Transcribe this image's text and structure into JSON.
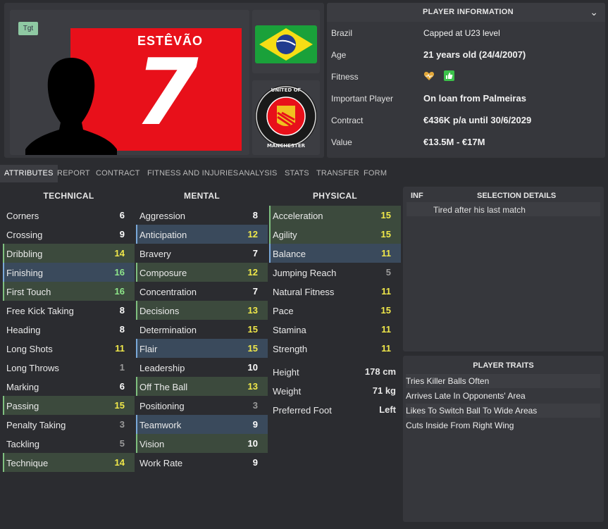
{
  "profile": {
    "badge": "Tgt",
    "shirt_name": "ESTÊVÃO",
    "shirt_number": "7",
    "flag": "Brazil flag",
    "club_crest_text": "FOOTBALL CLUB UNITED OF MANCHESTER"
  },
  "player_info": {
    "title": "PLAYER INFORMATION",
    "rows": [
      {
        "label": "Brazil",
        "value": "Capped at U23 level"
      },
      {
        "label": "Age",
        "value": "21 years old (24/4/2007)"
      },
      {
        "label": "Fitness",
        "value": ""
      },
      {
        "label": "Important Player",
        "value": "On loan from Palmeiras"
      },
      {
        "label": "Contract",
        "value": "€436K p/a until 30/6/2029"
      },
      {
        "label": "Value",
        "value": "€13.5M - €17M"
      }
    ]
  },
  "tabs": [
    "ATTRIBUTES",
    "REPORT",
    "CONTRACT",
    "FITNESS AND INJURIES",
    "ANALYSIS",
    "STATS",
    "TRANSFER",
    "FORM"
  ],
  "columns": {
    "technical": "TECHNICAL",
    "mental": "MENTAL",
    "physical": "PHYSICAL"
  },
  "technical": [
    {
      "name": "Corners",
      "value": "6"
    },
    {
      "name": "Crossing",
      "value": "9"
    },
    {
      "name": "Dribbling",
      "value": "14"
    },
    {
      "name": "Finishing",
      "value": "16"
    },
    {
      "name": "First Touch",
      "value": "16"
    },
    {
      "name": "Free Kick Taking",
      "value": "8"
    },
    {
      "name": "Heading",
      "value": "8"
    },
    {
      "name": "Long Shots",
      "value": "11"
    },
    {
      "name": "Long Throws",
      "value": "1"
    },
    {
      "name": "Marking",
      "value": "6"
    },
    {
      "name": "Passing",
      "value": "15"
    },
    {
      "name": "Penalty Taking",
      "value": "3"
    },
    {
      "name": "Tackling",
      "value": "5"
    },
    {
      "name": "Technique",
      "value": "14"
    }
  ],
  "mental": [
    {
      "name": "Aggression",
      "value": "8"
    },
    {
      "name": "Anticipation",
      "value": "12"
    },
    {
      "name": "Bravery",
      "value": "7"
    },
    {
      "name": "Composure",
      "value": "12"
    },
    {
      "name": "Concentration",
      "value": "7"
    },
    {
      "name": "Decisions",
      "value": "13"
    },
    {
      "name": "Determination",
      "value": "15"
    },
    {
      "name": "Flair",
      "value": "15"
    },
    {
      "name": "Leadership",
      "value": "10"
    },
    {
      "name": "Off The Ball",
      "value": "13"
    },
    {
      "name": "Positioning",
      "value": "3"
    },
    {
      "name": "Teamwork",
      "value": "9"
    },
    {
      "name": "Vision",
      "value": "10"
    },
    {
      "name": "Work Rate",
      "value": "9"
    }
  ],
  "physical": [
    {
      "name": "Acceleration",
      "value": "15"
    },
    {
      "name": "Agility",
      "value": "15"
    },
    {
      "name": "Balance",
      "value": "11"
    },
    {
      "name": "Jumping Reach",
      "value": "5"
    },
    {
      "name": "Natural Fitness",
      "value": "11"
    },
    {
      "name": "Pace",
      "value": "15"
    },
    {
      "name": "Stamina",
      "value": "11"
    },
    {
      "name": "Strength",
      "value": "11"
    }
  ],
  "bio": [
    {
      "name": "Height",
      "value": "178 cm"
    },
    {
      "name": "Weight",
      "value": "71 kg"
    },
    {
      "name": "Preferred Foot",
      "value": "Left"
    }
  ],
  "selection": {
    "inf_label": "INF",
    "title": "SELECTION DETAILS",
    "rows": [
      "Tired after his last match"
    ]
  },
  "traits": {
    "title": "PLAYER TRAITS",
    "items": [
      "Tries Killer Balls Often",
      "Arrives Late In Opponents' Area",
      "Likes To Switch Ball To Wide Areas",
      "Cuts Inside From Right Wing"
    ]
  },
  "colors": {
    "value_high": "#8ee68a",
    "value_good": "#f0e84a",
    "value_mid": "#ffffff",
    "value_low": "#9a9a9a"
  }
}
